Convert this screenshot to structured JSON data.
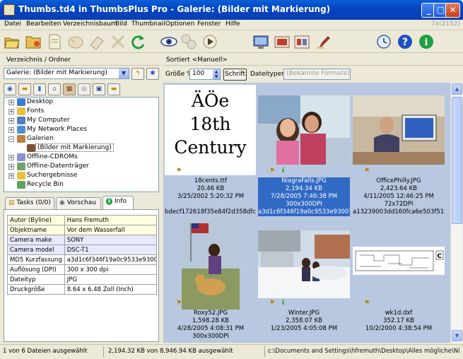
{
  "window": {
    "title": "Thumbs.td4 in ThumbsPlus Pro - Galerie: (Bilder mit Markierung)"
  },
  "menu": {
    "items": [
      "Datei",
      "Bearbeiten",
      "Verzeichnisbaum",
      "Bild",
      "Thumbnail",
      "Optionen",
      "Fenster",
      "Hilfe"
    ],
    "counter": "7x(2152)"
  },
  "toolbar": {
    "icons": [
      "open-folder-icon",
      "folder-tag-icon",
      "document-icon",
      "palette-icon",
      "eraser-icon",
      "collapse-icon",
      "refresh-icon",
      "view-eye-icon",
      "film-icon",
      "slideshow-icon",
      "monitor-icon",
      "scan-icon",
      "print-icon",
      "pin-icon",
      "stamp-icon",
      "clock-icon",
      "help-icon",
      "info-icon"
    ]
  },
  "left": {
    "header": "Verzeichnis / Ordner",
    "gallery_select": "Galerie: (Bilder mit Markierung)",
    "tree": [
      {
        "label": "Desktop",
        "expander": "+",
        "indent": 0,
        "color": "#3a7bd5"
      },
      {
        "label": "Fonts",
        "expander": "+",
        "indent": 0,
        "color": "#e8c040"
      },
      {
        "label": "My Computer",
        "expander": "+",
        "indent": 0,
        "color": "#5080c0"
      },
      {
        "label": "My Network Places",
        "expander": "+",
        "indent": 0,
        "color": "#4a90d0"
      },
      {
        "label": "Galerien",
        "expander": "−",
        "indent": 0,
        "color": "#c08040"
      },
      {
        "label": "(Bilder mit Markierung)",
        "expander": "",
        "indent": 1,
        "color": "#805030",
        "selected": true
      },
      {
        "label": "Offline-CDROMs",
        "expander": "+",
        "indent": 0,
        "color": "#9090d0"
      },
      {
        "label": "Offline-Datenträger",
        "expander": "+",
        "indent": 0,
        "color": "#70a070"
      },
      {
        "label": "Suchergebnisse",
        "expander": "+",
        "indent": 0,
        "color": "#e8c040"
      },
      {
        "label": "Recycle Bin",
        "expander": "",
        "indent": 0,
        "color": "#60a060"
      }
    ],
    "tabs": {
      "tasks": "Tasks (0/0)",
      "preview": "Vorschau",
      "info": "Info"
    },
    "info_rows": [
      {
        "k": "Autor (Byline)",
        "v": "Hans Fremuth"
      },
      {
        "k": "Objektname",
        "v": "Vor dem Wasserfall"
      },
      {
        "k": "Camera make",
        "v": "SONY"
      },
      {
        "k": "Camera model",
        "v": "DSC-T1"
      },
      {
        "k": "MD5 Kurzfassung",
        "v": "a3d1c6f346f19a0c9533e93007..."
      },
      {
        "k": "Auflösung (DPI)",
        "v": "300 x 300 dpi"
      },
      {
        "k": "Dateityp",
        "v": "JPG"
      },
      {
        "k": "Druckgröße",
        "v": "8.64 x 6.48 Zoll (Inch)"
      }
    ]
  },
  "right": {
    "header": "Sortiert <Manuell>",
    "size_label": "Größe %",
    "size_value": "100",
    "font_button": "Schrift",
    "filetypes_label": "Dateitypen:",
    "filetypes_value": "(Bekannte Formate)"
  },
  "thumbs": [
    {
      "name": "18cents.ttf",
      "size": "20.46 KB",
      "date": "3/25/2002  5:20:32 PM",
      "md5": "bdecf172618f35e84f2d358dfc...",
      "font_sample": [
        "ÄÖe",
        "18th",
        "Century"
      ],
      "info_icon": false,
      "selected": false
    },
    {
      "name": "NiagraFalls.JPG",
      "size": "2,194.34 KB",
      "date": "7/28/2005  7:46:38 PM",
      "dpi": "300x300DPI",
      "md5": "a3d1c6f346f19a0c9533e93007...",
      "info_icon": true,
      "selected": true
    },
    {
      "name": "OfficePhilly.JPG",
      "size": "2,423.64 KB",
      "date": "4/11/2005 12:46:25 PM",
      "dpi": "72x72DPI",
      "md5": "a13239003dd160fca6e503f51f...",
      "info_icon": false,
      "selected": false
    },
    {
      "name": "Roxy52.JPG",
      "size": "1,598.28 KB",
      "date": "4/28/2005  4:08:31 PM",
      "dpi": "300x300DPI",
      "info_icon": false,
      "selected": false
    },
    {
      "name": "Winter.JPG",
      "size": "2,358.07 KB",
      "date": "1/23/2005  4:05:08 PM",
      "info_icon": true,
      "selected": false
    },
    {
      "name": "wk1d.dxf",
      "size": "352.17 KB",
      "date": "10/2/2000  4:38:54 PM",
      "info_icon": false,
      "selected": false
    }
  ],
  "status": {
    "selection": "1 von 6 Dateien ausgewählt",
    "size": "2,194.32 KB von 8,946.94 KB ausgewählt",
    "path": "c:\\Documents and Settings\\hfremuth\\Desktop\\Alles mögliche\\NiagraFa"
  }
}
